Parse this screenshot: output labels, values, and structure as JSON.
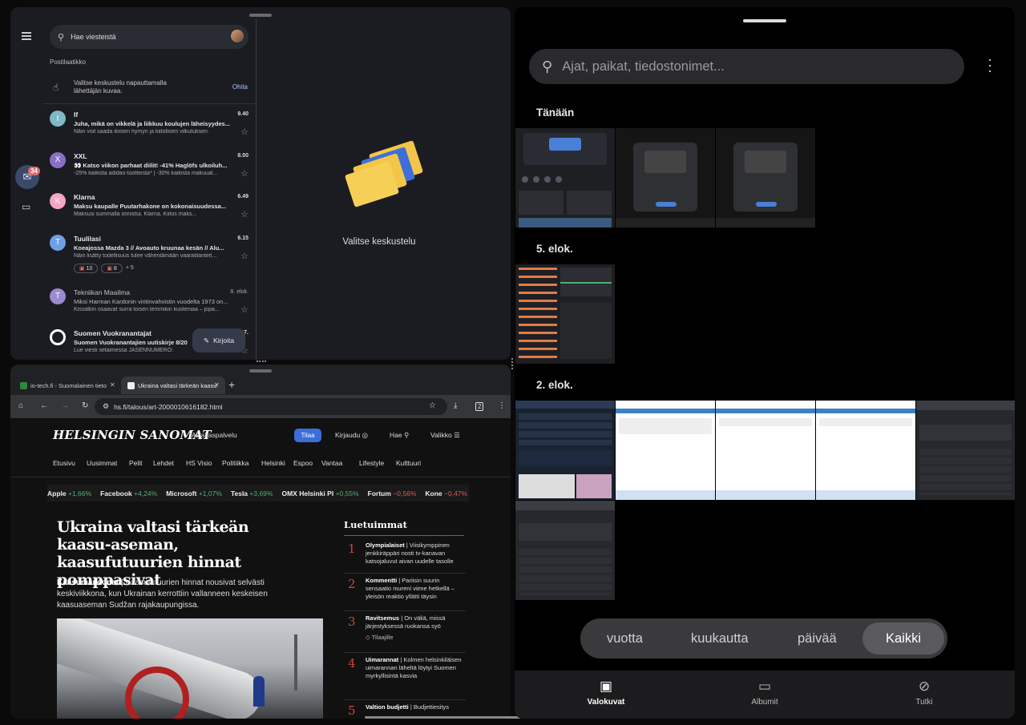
{
  "gmail": {
    "search_placeholder": "Hae viesteistä",
    "folder": "Postilaatikko",
    "tip_text": "Valitse keskustelu napauttamalla lähettäjän kuvaa.",
    "tip_dismiss": "Ohita",
    "unread_badge": "34",
    "compose_label": "Kirjoita",
    "empty_label": "Valitse keskustelu",
    "emails": [
      {
        "initial": "I",
        "color": "#7fb8c7",
        "from": "If",
        "time": "9.40",
        "subject": "Juha, mikä on vikkelä ja liikkuu koulujen läheisyydes...",
        "snippet": "Näin voit saada iloisen hymyn ja kiitollisen vilkutuksen.",
        "unread": true
      },
      {
        "initial": "X",
        "color": "#8a6fc7",
        "from": "XXL",
        "time": "8.00",
        "subject": "👀 Katso viikon parhaat diilit! -41%  Haglöfs ulkoiluh...",
        "snippet": "-25% kaikista adidas-tuotteista* | -30% kaikista makuual...",
        "unread": true
      },
      {
        "initial": "K",
        "color": "#f5a6c0",
        "from": "Klarna",
        "time": "6.49",
        "subject": "Maksu kaupalle Puutarhakone on kokonaisuudessa...",
        "snippet": "Maksusi summalla onnistui. Klarna. Kiitos maks...",
        "unread": true
      },
      {
        "initial": "T",
        "color": "#6ea0e8",
        "from": "Tuulilasi",
        "time": "6.15",
        "subject": "Koeajossa Mazda 3 // Avoauto kruunaa kesän // Alu...",
        "snippet": "Näin lisätty todellisuus tulee vähentämään vaaratilanteit...",
        "unread": true,
        "chips": [
          "10",
          "8"
        ],
        "more": "+ 5"
      },
      {
        "initial": "T",
        "color": "#9a8ad0",
        "from": "Tekniikan Maailma",
        "time": "8. elok.",
        "subject": "Miksi Harman Kardonin viritinvahvistin vuodelta 1973 on...",
        "snippet": "Kissatkin osaavat surra toisen lemmikin kuolemaa – jopa...",
        "unread": false
      },
      {
        "initial": "",
        "color": "#ffffff",
        "from": "Suomen Vuokranantajat",
        "time": "7.",
        "subject": "Suomen Vuokranantajien uutiskirje 8/20",
        "snippet": "Lue viesti selaimessa JÄSENNUMERO: ",
        "unread": true
      }
    ]
  },
  "chrome": {
    "tabs": [
      "io-tech.fi - Suomalainen tieto",
      "Ukraina valtasi tärkeän kaasu"
    ],
    "url": "hs.fi/talous/art-2000010616182.html",
    "tab_count": "2"
  },
  "hs": {
    "logo": "HELSINGIN SANOMAT",
    "service": "Asiakaspalvelu",
    "subscribe": "Tilaa",
    "login": "Kirjaudu",
    "search": "Hae",
    "menu": "Valikko",
    "sections": [
      "Etusivu",
      "Uusimmat",
      "Pelit",
      "Lehdet",
      "HS Visio",
      "Politiikka",
      "Helsinki",
      "Espoo",
      "Vantaa",
      "Lifestyle",
      "Kulttuuri"
    ],
    "ticker": [
      {
        "name": "Apple",
        "change": "+1,66%",
        "dir": "up"
      },
      {
        "name": "Facebook",
        "change": "+4,24%",
        "dir": "up"
      },
      {
        "name": "Microsoft",
        "change": "+1,07%",
        "dir": "up"
      },
      {
        "name": "Tesla",
        "change": "+3,69%",
        "dir": "up"
      },
      {
        "name": "OMX Helsinki PI",
        "change": "+0,55%",
        "dir": "up"
      },
      {
        "name": "Fortum",
        "change": "−0,56%",
        "dir": "dn"
      },
      {
        "name": "Kone",
        "change": "−0,47%",
        "dir": "dn"
      },
      {
        "name": "N",
        "change": "",
        "dir": "up"
      }
    ],
    "headline": "Ukraina valtasi tärkeän kaasu-aseman, kaasufutuurien hinnat pomppasivat",
    "lead_tag": "Kaasumarkkinat",
    "lead": "Kaasufutuurien hinnat nousivat selvästi keskiviikkona, kun Ukrainan kerrottiin vallanneen keskeisen kaasuaseman Sudžan rajakaupungissa.",
    "most_read_title": "Luetuimmat",
    "most_read": [
      {
        "n": "1",
        "tag": "Olympialaiset",
        "text": "Viisikymppinen jenkkiräppäri nosti tv-kanavan katsojaluvut aivan uudelle tasolle"
      },
      {
        "n": "2",
        "tag": "Kommentti",
        "text": "Pariisin suurin sensaatio mureni viime hetkellä – yleisön reaktio yllätti täysin"
      },
      {
        "n": "3",
        "tag": "Ravitsemus",
        "text": "On väliä, missä järjestyksessä ruokansa syö",
        "extra": "Tilaajille"
      },
      {
        "n": "4",
        "tag": "Uimarannat",
        "text": "Kolmen helsinkiläisen uimarannan läheltä löytyi Suomen myrkyllisintä kasvia"
      },
      {
        "n": "5",
        "tag": "Valtion budjetti",
        "text": "Budjettiesitys"
      }
    ]
  },
  "photos": {
    "search_placeholder": "Ajat, paikat, tiedostonimet...",
    "groups": [
      "Tänään",
      "5. elok.",
      "2. elok."
    ],
    "segments": [
      "vuotta",
      "kuukautta",
      "päivää",
      "Kaikki"
    ],
    "nav": [
      "Valokuvat",
      "Albumit",
      "Tutki"
    ]
  }
}
